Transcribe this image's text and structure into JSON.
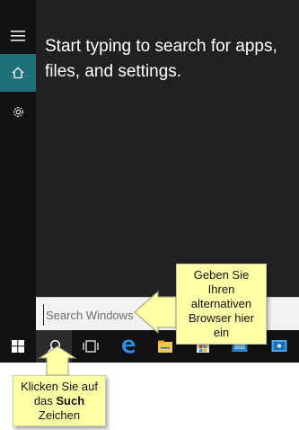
{
  "start": {
    "prompt": "Start typing to search for apps, files, and settings."
  },
  "rail": {
    "items": [
      {
        "icon": "hamburger-icon"
      },
      {
        "icon": "home-icon"
      },
      {
        "icon": "gear-icon"
      }
    ]
  },
  "search": {
    "placeholder": "Search Windows"
  },
  "taskbar": {
    "items": [
      "windows-logo-icon",
      "search-icon",
      "task-view-icon",
      "edge-icon",
      "file-explorer-icon",
      "store-icon",
      "app-icon"
    ]
  },
  "callouts": {
    "browser_hint": [
      "Geben Sie",
      "Ihren",
      "alternativen",
      "Browser hier",
      "ein"
    ],
    "search_hint_line1": "Klicken Sie auf",
    "search_hint_line2_pre": "das ",
    "search_hint_line2_bold": "Such",
    "search_hint_line3": "Zeichen"
  },
  "colors": {
    "accent": "#1e6f7a",
    "callout": "#ffffa8",
    "panel": "#202123",
    "taskbar": "#101113"
  }
}
